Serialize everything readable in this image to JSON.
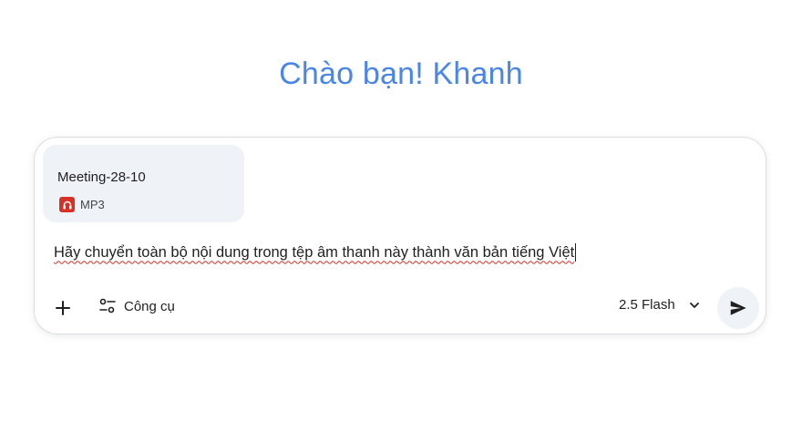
{
  "greeting": "Chào bạn! Khanh",
  "attachment": {
    "file_name": "Meeting-28-10",
    "file_type": "MP3",
    "icon": "audio-file-icon"
  },
  "prompt": {
    "text": "Hãy chuyển toàn bộ nội dung trong tệp âm thanh này thành văn bản tiếng Việt"
  },
  "toolbar": {
    "add_icon": "plus-icon",
    "tools_icon": "tune-icon",
    "tools_label": "Công cụ",
    "model_label": "2.5 Flash",
    "model_icon": "chevron-down-icon",
    "send_icon": "send-icon"
  },
  "colors": {
    "greeting": "#4a86e8",
    "attachment_bg": "#eff2f7",
    "mp3_icon": "#d93025",
    "spellcheck": "#d93025"
  }
}
